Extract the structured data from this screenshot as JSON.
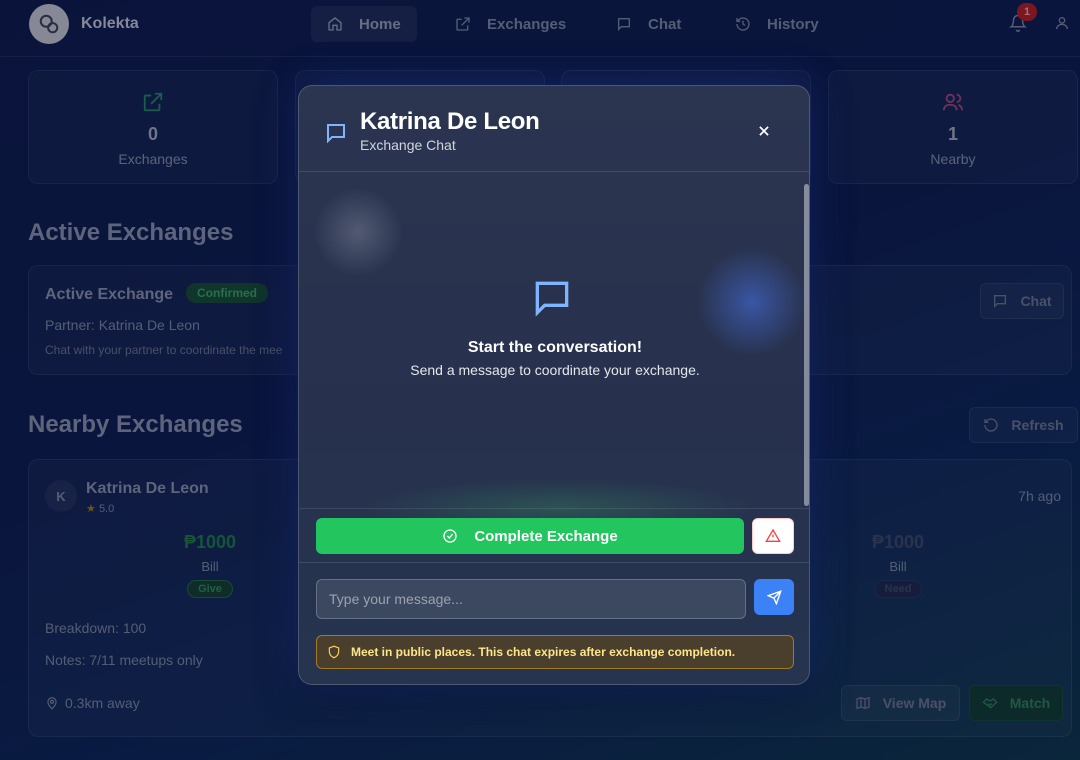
{
  "app": {
    "brand": "Kolekta"
  },
  "nav": {
    "items": [
      {
        "label": "Home",
        "icon": "home-icon",
        "active": true
      },
      {
        "label": "Exchanges",
        "icon": "external-link-icon",
        "active": false
      },
      {
        "label": "Chat",
        "icon": "chat-icon",
        "active": false
      },
      {
        "label": "History",
        "icon": "history-icon",
        "active": false
      }
    ],
    "notification_count": "1"
  },
  "stats": [
    {
      "value": "0",
      "label": "Exchanges",
      "icon": "external-link-icon",
      "color": "#2bb673"
    },
    {
      "value": "1",
      "label": "Nearby",
      "icon": "users-icon",
      "color": "#d9468f"
    }
  ],
  "active_exchanges": {
    "title": "Active Exchanges",
    "card": {
      "title": "Active Exchange",
      "status": "Confirmed",
      "partner": "Partner: Katrina De Leon",
      "description": "Chat with your partner to coordinate the mee",
      "chat_button": "Chat"
    }
  },
  "nearby": {
    "title": "Nearby Exchanges",
    "refresh_button": "Refresh",
    "card": {
      "avatar_initial": "K",
      "name": "Katrina De Leon",
      "rating": "5.0",
      "time_ago": "7h ago",
      "give": {
        "amount": "₱1000",
        "type": "Bill",
        "tag": "Give"
      },
      "need": {
        "amount": "₱1000",
        "type": "Bill",
        "tag": "Need"
      },
      "breakdown": "Breakdown: 100",
      "notes": "Notes: 7/11 meetups only",
      "distance": "0.3km away",
      "view_map_button": "View Map",
      "match_button": "Match"
    }
  },
  "modal": {
    "title": "Katrina De Leon",
    "subtitle": "Exchange Chat",
    "empty_title": "Start the conversation!",
    "empty_subtitle": "Send a message to coordinate your exchange.",
    "complete_button": "Complete Exchange",
    "input_placeholder": "Type your message...",
    "input_value": "",
    "safety_notice": "Meet in public places. This chat expires after exchange completion.",
    "colors": {
      "primary": "#3b82f6",
      "success": "#22c55e",
      "danger": "#ef4444",
      "warning": "#fde68a"
    }
  }
}
